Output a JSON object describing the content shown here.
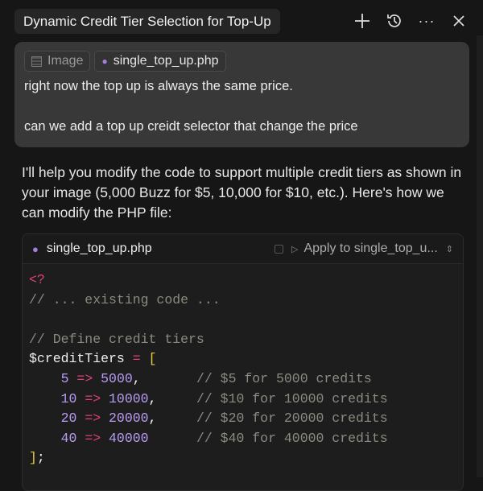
{
  "header": {
    "title": "Dynamic Credit Tier Selection for Top-Up"
  },
  "message": {
    "chips": [
      {
        "label": "Image",
        "icon": "image-icon"
      },
      {
        "label": "single_top_up.php",
        "icon": "php-elephant-icon"
      }
    ],
    "lines": [
      "right now the top up is always the same price.",
      "can we add a top up creidt selector that change the price"
    ]
  },
  "response": {
    "text": "I'll help you modify the code to support multiple credit tiers as shown in your image (5,000 Buzz for $5, 10,000 for $10, etc.). Here's how we can modify the PHP file:"
  },
  "code_block": {
    "filename": "single_top_up.php",
    "apply_label": "Apply to single_top_u...",
    "lines": [
      [
        {
          "t": "<?",
          "c": "kw"
        }
      ],
      [
        {
          "t": "// ... existing code ...",
          "c": "cm"
        }
      ],
      [],
      [
        {
          "t": "// Define credit tiers",
          "c": "cm"
        }
      ],
      [
        {
          "t": "$creditTiers ",
          "c": "var"
        },
        {
          "t": "=",
          "c": "kw"
        },
        {
          "t": " ",
          "c": "pl"
        },
        {
          "t": "[",
          "c": "br"
        }
      ],
      [
        {
          "t": "    5 ",
          "c": "num"
        },
        {
          "t": "=>",
          "c": "kw"
        },
        {
          "t": " 5000",
          "c": "num"
        },
        {
          "t": ",       ",
          "c": "pl"
        },
        {
          "t": "// $5 for 5000 credits",
          "c": "cm"
        }
      ],
      [
        {
          "t": "    10 ",
          "c": "num"
        },
        {
          "t": "=>",
          "c": "kw"
        },
        {
          "t": " 10000",
          "c": "num"
        },
        {
          "t": ",     ",
          "c": "pl"
        },
        {
          "t": "// $10 for 10000 credits",
          "c": "cm"
        }
      ],
      [
        {
          "t": "    20 ",
          "c": "num"
        },
        {
          "t": "=>",
          "c": "kw"
        },
        {
          "t": " 20000",
          "c": "num"
        },
        {
          "t": ",     ",
          "c": "pl"
        },
        {
          "t": "// $20 for 20000 credits",
          "c": "cm"
        }
      ],
      [
        {
          "t": "    40 ",
          "c": "num"
        },
        {
          "t": "=>",
          "c": "kw"
        },
        {
          "t": " 40000",
          "c": "num"
        },
        {
          "t": "      ",
          "c": "pl"
        },
        {
          "t": "// $40 for 40000 credits",
          "c": "cm"
        }
      ],
      [
        {
          "t": "]",
          "c": "br"
        },
        {
          "t": ";",
          "c": "pl"
        }
      ]
    ]
  }
}
